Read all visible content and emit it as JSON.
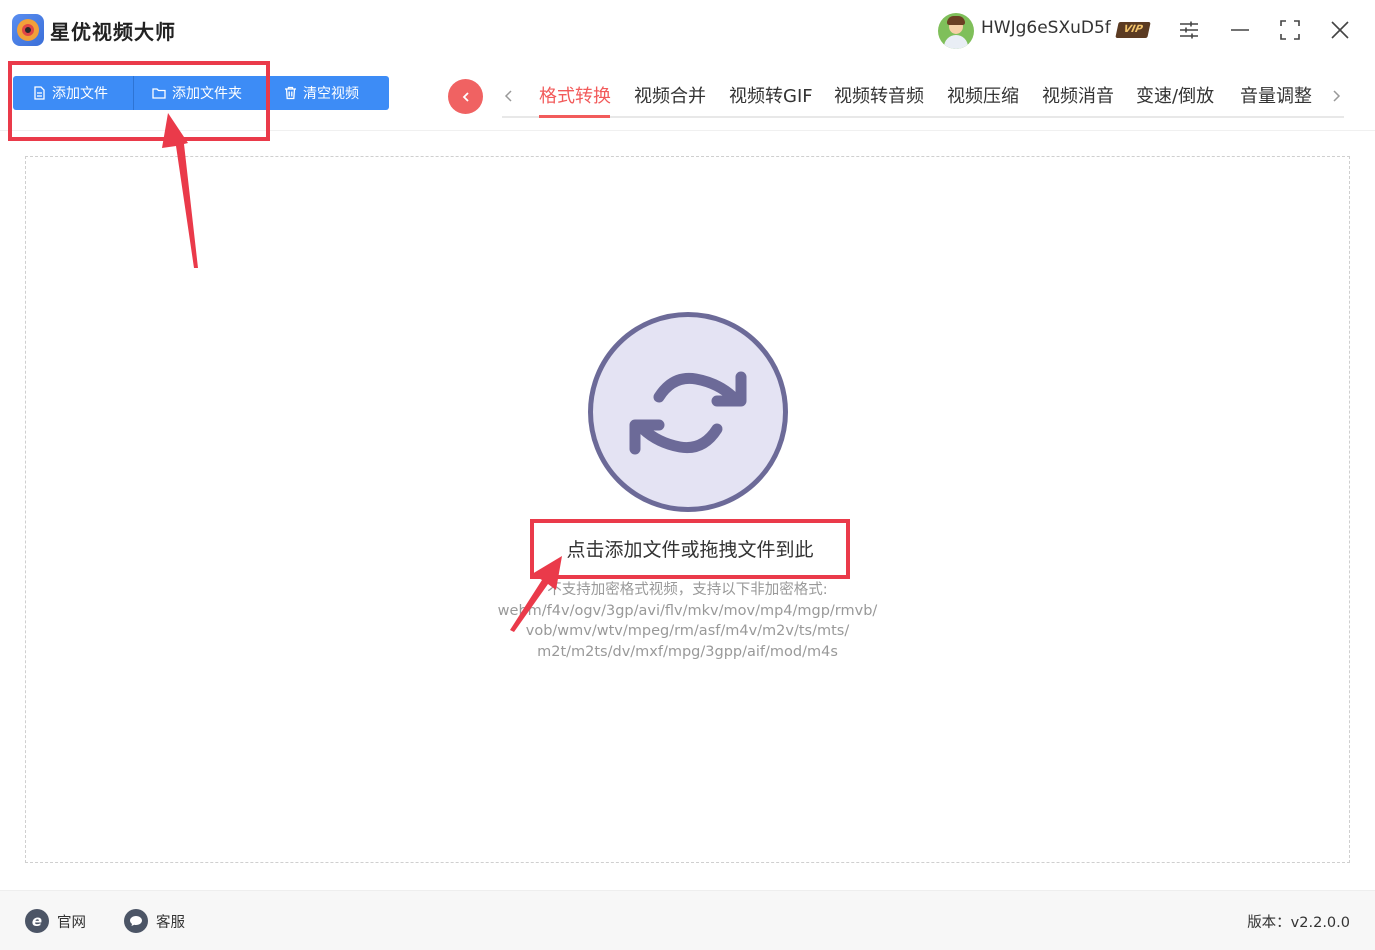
{
  "app": {
    "title": "星优视频大师",
    "username": "HWJg6eSXuD5f",
    "vip_label": "VIP"
  },
  "toolbar": {
    "add_file": "添加文件",
    "add_folder": "添加文件夹",
    "clear_video": "清空视频"
  },
  "tabs": [
    {
      "label": "格式转换",
      "active": true
    },
    {
      "label": "视频合并"
    },
    {
      "label": "视频转GIF"
    },
    {
      "label": "视频转音频"
    },
    {
      "label": "视频压缩"
    },
    {
      "label": "视频消音"
    },
    {
      "label": "变速/倒放"
    },
    {
      "label": "音量调整"
    }
  ],
  "dropzone": {
    "prompt": "点击添加文件或拖拽文件到此",
    "format_line1": "不支持加密格式视频，支持以下非加密格式:",
    "format_line2": "webm/f4v/ogv/3gp/avi/flv/mkv/mov/mp4/mgp/rmvb/",
    "format_line3": "vob/wmv/wtv/mpeg/rm/asf/m4v/m2v/ts/mts/",
    "format_line4": "m2t/m2ts/dv/mxf/mpg/3gpp/aif/mod/m4s"
  },
  "footer": {
    "website": "官网",
    "support": "客服",
    "version": "版本：v2.2.0.0"
  },
  "colors": {
    "primary_button": "#3d8cf6",
    "active_tab": "#f25b5b",
    "annotation": "#ea3a4a",
    "convert_icon": "#6c6a98",
    "convert_circle_fill": "#e4e3f3"
  },
  "icons": {
    "app_logo": "camera-lens-icon",
    "settings": "sliders-icon",
    "minimize": "minimize-icon",
    "maximize": "maximize-icon",
    "close": "close-icon",
    "add_file": "file-icon",
    "add_folder": "folder-icon",
    "clear": "trash-icon",
    "convert": "refresh-icon",
    "website": "ie-icon",
    "support": "chat-bubble-icon"
  }
}
